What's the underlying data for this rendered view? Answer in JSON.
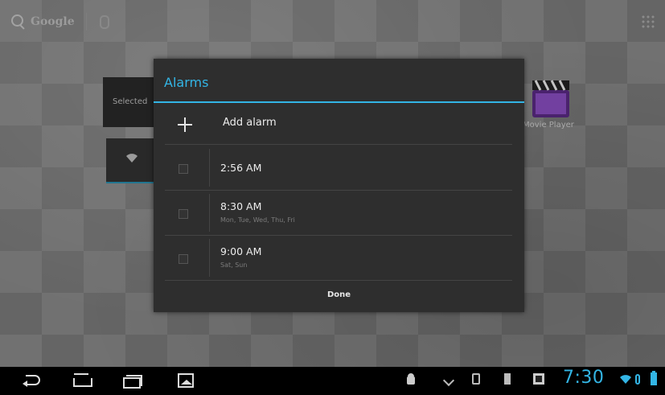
{
  "home": {
    "search_brand": "Google",
    "widget_selected_label": "Selected",
    "movie_player_label": "Movie Player"
  },
  "dialog": {
    "title": "Alarms",
    "add_label": "Add alarm",
    "alarms": [
      {
        "time": "2:56 AM",
        "days": "",
        "enabled": false
      },
      {
        "time": "8:30 AM",
        "days": "Mon, Tue, Wed, Thu, Fri",
        "enabled": false
      },
      {
        "time": "9:00 AM",
        "days": "Sat, Sun",
        "enabled": false
      }
    ],
    "done_label": "Done"
  },
  "system_bar": {
    "clock": "7:30",
    "accent_color": "#33b5e5"
  }
}
